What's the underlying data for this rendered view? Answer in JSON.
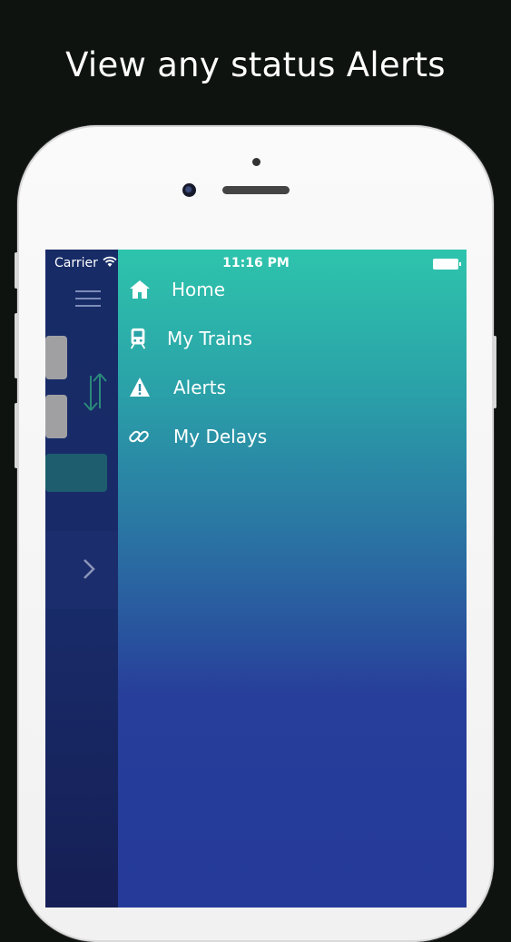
{
  "promo": {
    "title": "View any status Alerts"
  },
  "status_bar": {
    "carrier": "Carrier",
    "time": "11:16 PM"
  },
  "drawer": {
    "items": [
      {
        "label": "Home",
        "icon": "home-icon"
      },
      {
        "label": "My Trains",
        "icon": "train-icon"
      },
      {
        "label": "Alerts",
        "icon": "alert-icon"
      },
      {
        "label": "My Delays",
        "icon": "link-icon"
      }
    ]
  },
  "colors": {
    "background": "#0e130f",
    "drawer_top": "#2ec4ac",
    "drawer_bottom": "#253a99",
    "behind_panel": "#172b66"
  }
}
